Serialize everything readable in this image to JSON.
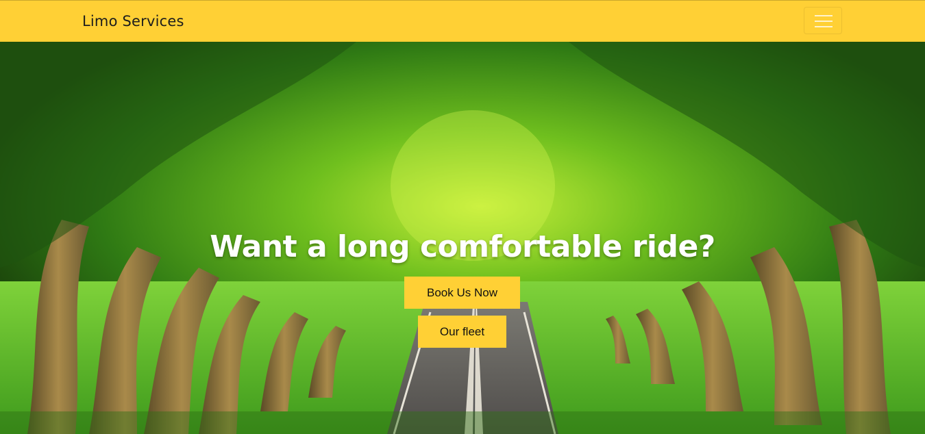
{
  "navbar": {
    "brand": "Limo Services",
    "menu_icon": "hamburger-icon"
  },
  "hero": {
    "headline": "Want a long comfortable ride?",
    "background": "tree-lined-road-photo",
    "book_button": "Book Us Now",
    "fleet_button": "Our fleet"
  },
  "colors": {
    "accent": "#ffd035",
    "headline": "#ffffff"
  }
}
